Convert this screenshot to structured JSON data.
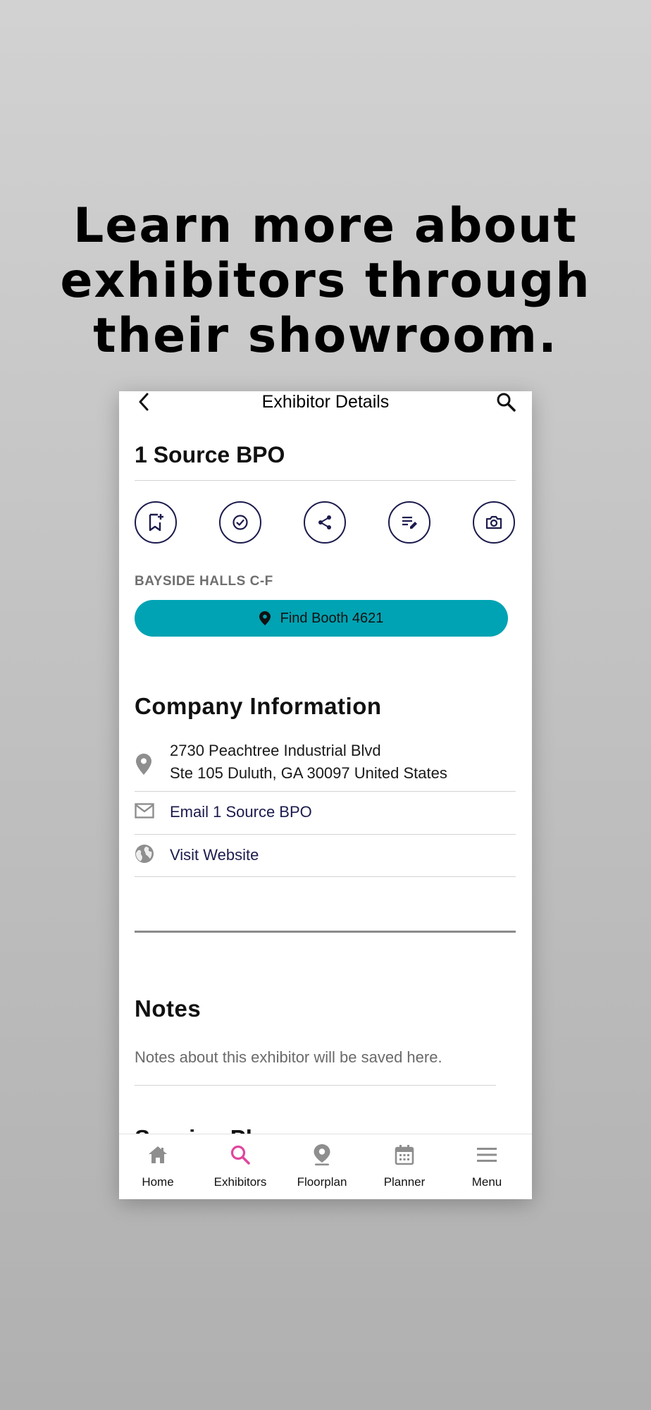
{
  "promo": {
    "headline_lines": [
      "Learn more about",
      "exhibitors through",
      "their showroom."
    ]
  },
  "navbar": {
    "title": "Exhibitor Details",
    "back_icon": "chevron-left-icon",
    "search_icon": "search-icon"
  },
  "exhibitor": {
    "name": "1 Source BPO",
    "hall": "BAYSIDE HALLS C-F",
    "find_booth_label": "Find Booth 4621"
  },
  "actions": [
    {
      "name": "bookmark-add",
      "icon": "bookmark-add-icon"
    },
    {
      "name": "check",
      "icon": "check-circle-icon"
    },
    {
      "name": "share",
      "icon": "share-icon"
    },
    {
      "name": "notes",
      "icon": "note-edit-icon"
    },
    {
      "name": "photo",
      "icon": "camera-icon"
    }
  ],
  "company_info": {
    "title": "Company Information",
    "address_line1": "2730 Peachtree Industrial Blvd",
    "address_line2": "Ste 105 Duluth, GA 30097 United States",
    "email_label": "Email 1 Source BPO",
    "website_label": "Visit Website"
  },
  "notes": {
    "title": "Notes",
    "placeholder": "Notes about this exhibitor will be saved here."
  },
  "next_section_partial": "Session Pl",
  "tabbar": {
    "items": [
      {
        "label": "Home",
        "icon": "home-icon",
        "active": false
      },
      {
        "label": "Exhibitors",
        "icon": "search-icon",
        "active": true
      },
      {
        "label": "Floorplan",
        "icon": "map-pin-icon",
        "active": false
      },
      {
        "label": "Planner",
        "icon": "calendar-icon",
        "active": false
      },
      {
        "label": "Menu",
        "icon": "menu-icon",
        "active": false
      }
    ]
  },
  "colors": {
    "accent_teal": "#00a3b3",
    "navy": "#1c1b4d",
    "active_tab": "#e0479e",
    "inactive_icon": "#8e8e8e"
  }
}
